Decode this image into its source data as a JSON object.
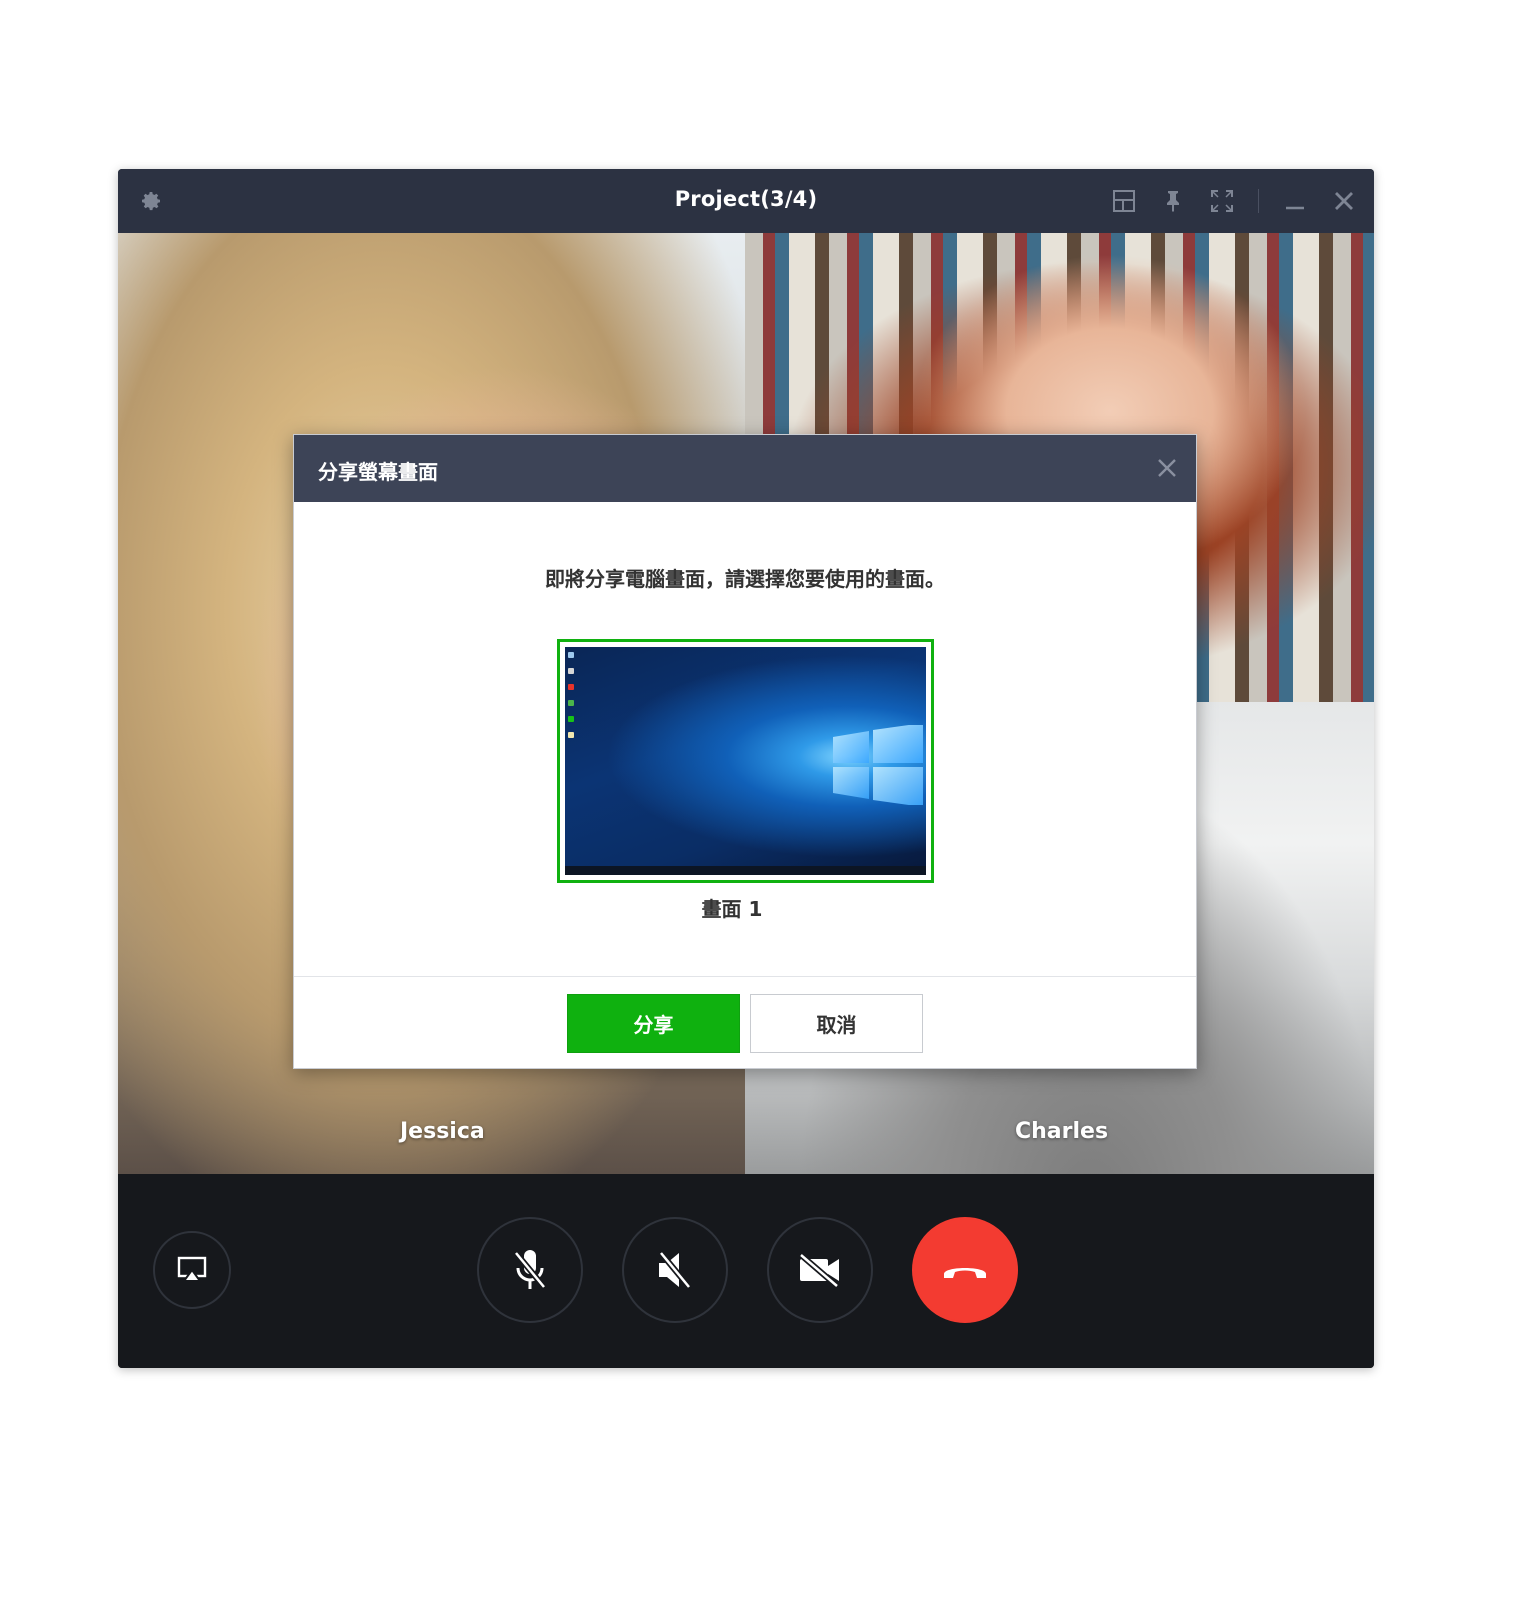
{
  "window": {
    "title": "Project(3/4)",
    "titlebar_icons": [
      "gear-icon",
      "layout-icon",
      "pin-icon",
      "fullscreen-icon",
      "minimize-icon",
      "close-icon"
    ]
  },
  "participants": [
    {
      "name": "Jessica"
    },
    {
      "name": ""
    },
    {
      "name": "Charles"
    }
  ],
  "controls": {
    "buttons": [
      "screen-share-icon",
      "mic-muted-icon",
      "speaker-muted-icon",
      "video-off-icon",
      "end-call-icon"
    ],
    "end_call_color": "#f33b31"
  },
  "dialog": {
    "title": "分享螢幕畫面",
    "message": "即將分享電腦畫面，請選擇您要使用的畫面。",
    "screens": [
      {
        "label": "畫面 1",
        "selected": true
      }
    ],
    "share_button": "分享",
    "cancel_button": "取消",
    "accent_color": "#10b110"
  }
}
